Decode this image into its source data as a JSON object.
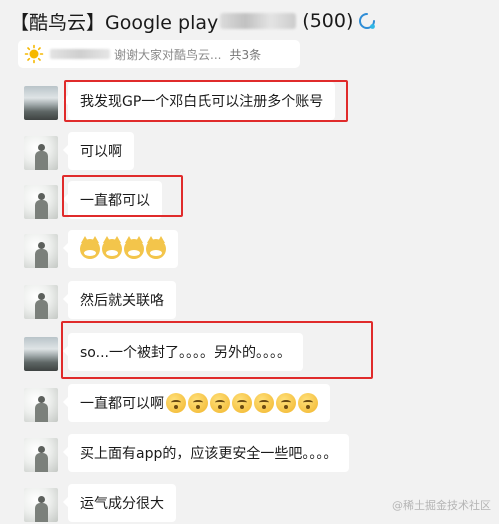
{
  "header": {
    "title_prefix": "【酷鸟云】Google play",
    "title_count": "(500)",
    "notice_text": "谢谢大家对酷鸟云...",
    "notice_count": "共3条"
  },
  "messages": [
    {
      "text": "我发现GP一个邓白氏可以注册多个账号",
      "avatar": "mountain"
    },
    {
      "text": "可以啊",
      "avatar": "person"
    },
    {
      "text": "一直都可以",
      "avatar": "person"
    },
    {
      "text": "",
      "avatar": "person",
      "emoji": "cat",
      "emoji_count": 4
    },
    {
      "text": "然后就关联咯",
      "avatar": "person"
    },
    {
      "text": "so...一个被封了。。。。另外的。。。。",
      "avatar": "mountain"
    },
    {
      "text": "一直都可以啊",
      "avatar": "person",
      "emoji": "face",
      "emoji_count": 7
    },
    {
      "text": "买上面有app的，应该更安全一些吧。。。。",
      "avatar": "person"
    },
    {
      "text": "运气成分很大",
      "avatar": "person"
    }
  ],
  "watermark": "@稀土掘金技术社区",
  "colors": {
    "highlight": "#e02b2b",
    "background": "#f2f2f2"
  }
}
